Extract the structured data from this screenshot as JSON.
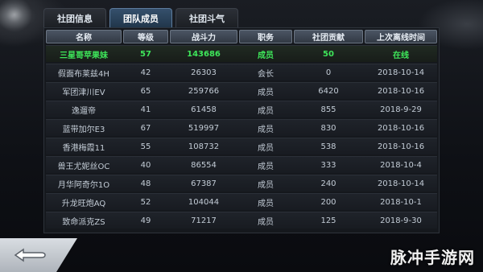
{
  "tabs": [
    {
      "label": "社团信息",
      "active": false
    },
    {
      "label": "团队成员",
      "active": true
    },
    {
      "label": "社团斗气",
      "active": false
    }
  ],
  "table": {
    "columns": [
      "名称",
      "等级",
      "战斗力",
      "职务",
      "社团贡献",
      "上次离线时间"
    ],
    "rows": [
      {
        "name": "三星哥苹果妹",
        "level": "57",
        "power": "143686",
        "role": "成员",
        "contribution": "50",
        "last_offline": "在线",
        "highlight": true
      },
      {
        "name": "假面布莱兹4H",
        "level": "42",
        "power": "26303",
        "role": "会长",
        "contribution": "0",
        "last_offline": "2018-10-14"
      },
      {
        "name": "军团津川EV",
        "level": "65",
        "power": "259766",
        "role": "成员",
        "contribution": "6420",
        "last_offline": "2018-10-16"
      },
      {
        "name": "逸遛帝",
        "level": "41",
        "power": "61458",
        "role": "成员",
        "contribution": "855",
        "last_offline": "2018-9-29"
      },
      {
        "name": "蓝带加尔E3",
        "level": "67",
        "power": "519997",
        "role": "成员",
        "contribution": "830",
        "last_offline": "2018-10-16"
      },
      {
        "name": "香港梅霞11",
        "level": "55",
        "power": "108732",
        "role": "成员",
        "contribution": "538",
        "last_offline": "2018-10-16"
      },
      {
        "name": "兽王尤妮丝OC",
        "level": "40",
        "power": "86554",
        "role": "成员",
        "contribution": "333",
        "last_offline": "2018-10-4"
      },
      {
        "name": "月华阿奇尔1O",
        "level": "48",
        "power": "67387",
        "role": "成员",
        "contribution": "240",
        "last_offline": "2018-10-14"
      },
      {
        "name": "升龙旺炮AQ",
        "level": "52",
        "power": "104044",
        "role": "成员",
        "contribution": "200",
        "last_offline": "2018-10-1"
      },
      {
        "name": "致命派克ZS",
        "level": "49",
        "power": "71217",
        "role": "成员",
        "contribution": "125",
        "last_offline": "2018-9-30"
      }
    ]
  },
  "watermark": "脉冲手游网",
  "icons": {
    "back": "back-arrow-icon"
  },
  "colors": {
    "highlight_text": "#3ee65a",
    "active_tab": "#35506c"
  }
}
